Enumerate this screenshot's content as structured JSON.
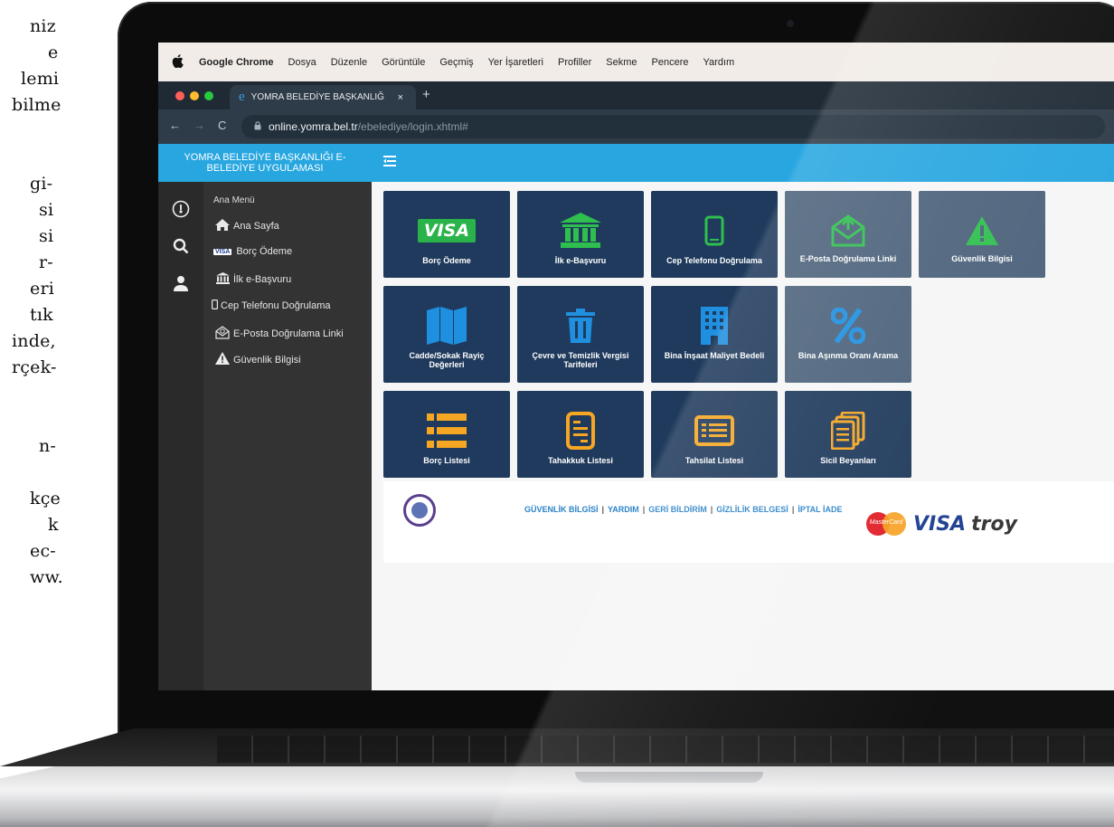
{
  "article_lines": [
    "niz",
    "e",
    "lemi",
    "bilme",
    "",
    "",
    "gi-",
    "si",
    "si",
    "r-",
    "eri",
    "tık",
    "inde,",
    "rçek-",
    "",
    "",
    "n-",
    "",
    "kçe",
    "k",
    "ec-",
    "ww."
  ],
  "mac_menu": {
    "items": [
      "Google Chrome",
      "Dosya",
      "Düzenle",
      "Görüntüle",
      "Geçmiş",
      "Yer İşaretleri",
      "Profiller",
      "Sekme",
      "Pencere",
      "Yardım"
    ]
  },
  "browser": {
    "tab_title": "YOMRA BELEDİYE BAŞKANLIĞ",
    "tab_close": "×",
    "new_tab": "+",
    "url_host": "online.yomra.bel.tr",
    "url_path": "/ebelediye/login.xhtml#"
  },
  "app": {
    "title_line1": "YOMRA BELEDİYE BAŞKANLIĞI E-",
    "title_line2": "BELEDİYE UYGULAMASI"
  },
  "sidebar": {
    "title": "Ana Menü",
    "items": [
      {
        "label": "Ana Sayfa",
        "icon": "home-icon"
      },
      {
        "label": "Borç Ödeme",
        "icon": "visa-icon"
      },
      {
        "label": "İlk e-Başvuru",
        "icon": "bank-icon"
      },
      {
        "label": "Cep Telefonu Doğrulama",
        "icon": "phone-icon"
      },
      {
        "label": "E-Posta Doğrulama Linki",
        "icon": "mail-icon"
      },
      {
        "label": "Güvenlik Bilgisi",
        "icon": "warning-icon"
      }
    ],
    "visa_mini": "VISA"
  },
  "tiles": [
    {
      "label": "Borç Ödeme",
      "icon": "visa-icon",
      "icon_text": "VISA",
      "color": "#29b34a"
    },
    {
      "label": "İlk e-Başvuru",
      "icon": "bank-icon",
      "color": "#2fbf4f"
    },
    {
      "label": "Cep Telefonu Doğrulama",
      "icon": "phone-icon",
      "color": "#2fbf4f"
    },
    {
      "label": "E-Posta Doğrulama Linki",
      "icon": "mail-icon",
      "color": "#2fbf4f"
    },
    {
      "label": "Güvenlik Bilgisi",
      "icon": "warning-icon",
      "color": "#2fbf4f"
    },
    {
      "label": "Cadde/Sokak Rayiç Değerleri",
      "icon": "map-icon",
      "color": "#1f8fe0"
    },
    {
      "label": "Çevre ve Temizlik Vergisi Tarifeleri",
      "icon": "trash-icon",
      "color": "#1f8fe0"
    },
    {
      "label": "Bina İnşaat Maliyet Bedeli",
      "icon": "building-icon",
      "color": "#1f8fe0"
    },
    {
      "label": "Bina Aşınma Oranı Arama",
      "icon": "percent-icon",
      "color": "#1f8fe0"
    },
    {
      "label": "Borç Listesi",
      "icon": "list-icon",
      "color": "#f5a623"
    },
    {
      "label": "Tahakkuk Listesi",
      "icon": "document-icon",
      "color": "#f5a623"
    },
    {
      "label": "Tahsilat Listesi",
      "icon": "receipt-icon",
      "color": "#f5a623"
    },
    {
      "label": "Sicil Beyanları",
      "icon": "files-icon",
      "color": "#f5a623"
    }
  ],
  "footer": {
    "links": [
      "GÜVENLİK BİLGİSİ",
      "YARDIM",
      "GERİ BİLDİRİM",
      "GİZLİLİK BELGESİ",
      "İPTAL İADE"
    ],
    "separator": "|",
    "mastercard": "MasterCard",
    "visa": "VISA",
    "troy": "troy"
  }
}
